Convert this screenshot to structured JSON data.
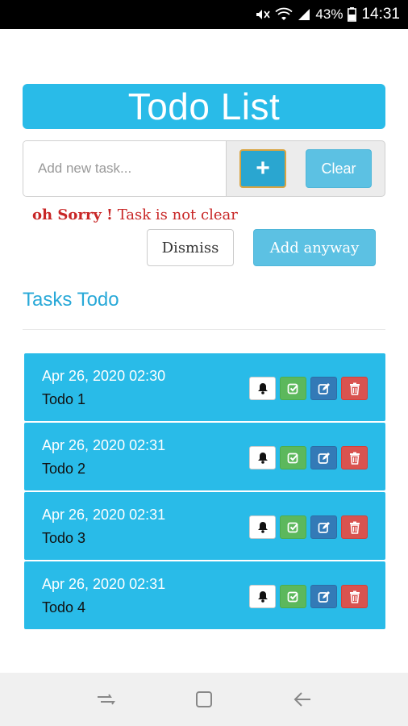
{
  "status_bar": {
    "battery": "43%",
    "time": "14:31",
    "icons": [
      "mute-icon",
      "wifi-icon",
      "signal-icon",
      "battery-icon"
    ]
  },
  "app": {
    "title": "Todo List"
  },
  "input": {
    "placeholder": "Add new task...",
    "value": ""
  },
  "buttons": {
    "add_label": "+",
    "clear_label": "Clear"
  },
  "alert": {
    "bold": "oh Sorry !",
    "message": " Task is not clear",
    "dismiss_label": "Dismiss",
    "add_anyway_label": "Add anyway"
  },
  "section": {
    "title": "Tasks Todo"
  },
  "tasks": [
    {
      "date": "Apr 26, 2020 02:30",
      "name": "Todo 1"
    },
    {
      "date": "Apr 26, 2020 02:31",
      "name": "Todo 2"
    },
    {
      "date": "Apr 26, 2020 02:31",
      "name": "Todo 3"
    },
    {
      "date": "Apr 26, 2020 02:31",
      "name": "Todo 4"
    }
  ],
  "task_actions": [
    "bell-icon",
    "check-icon",
    "edit-icon",
    "trash-icon"
  ],
  "colors": {
    "primary": "#29bbe8",
    "success": "#5cb85c",
    "info": "#337ab7",
    "danger": "#d9534f",
    "alert_text": "#c82626"
  },
  "nav_bar": {
    "icons": [
      "recents-icon",
      "home-icon",
      "back-icon"
    ]
  }
}
